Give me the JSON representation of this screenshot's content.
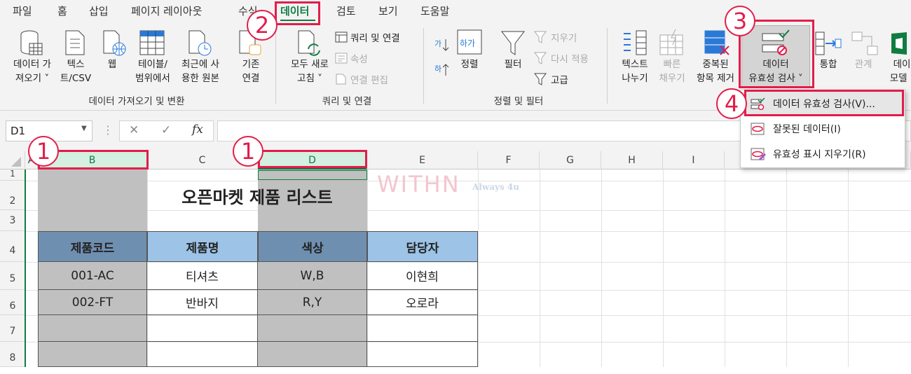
{
  "tabs": [
    "파일",
    "홈",
    "삽입",
    "페이지 레이아웃",
    "수식",
    "데이터",
    "검토",
    "보기",
    "도움말"
  ],
  "active_tab": "데이터",
  "ribbon": {
    "get_data": [
      "데이터 가",
      "져오기 ˅"
    ],
    "text_csv": [
      "텍스",
      "트/CSV"
    ],
    "web": [
      "웹"
    ],
    "table_range": [
      "테이블/",
      "범위에서"
    ],
    "recent_sources": [
      "최근에 사",
      "용한 원본"
    ],
    "existing_conn": [
      "기존",
      "연결"
    ],
    "refresh_all": [
      "모두 새로",
      "고침 ˅"
    ],
    "queries_connections": "쿼리 및 연결",
    "properties": "속성",
    "edit_links": "연결 편집",
    "sort": "정렬",
    "filter": "필터",
    "clear": "지우기",
    "reapply": "다시 적용",
    "advanced": "고급",
    "text_to_columns": [
      "텍스트",
      "나누기"
    ],
    "flash_fill": [
      "빠른",
      "채우기"
    ],
    "remove_duplicates": [
      "중복된",
      "항목 제거"
    ],
    "data_validation": [
      "데이터",
      "유효성 검사 ˅"
    ],
    "consolidate": "통합",
    "relationships": "관계",
    "data_model": [
      "데이",
      "모델 ›"
    ],
    "groups": {
      "get_transform": "데이터 가져오기 및 변환",
      "queries": "쿼리 및 연결",
      "sort_filter": "정렬 및 필터"
    }
  },
  "name_box": "D1",
  "formula_icons": {
    "cancel": "✕",
    "enter": "✓",
    "fx": "fx"
  },
  "columns": [
    "A",
    "B",
    "C",
    "D",
    "E",
    "F",
    "G",
    "H",
    "I"
  ],
  "rows": [
    "1",
    "2",
    "3",
    "4",
    "5",
    "6",
    "7",
    "8"
  ],
  "sheet": {
    "title": "오픈마켓 제품 리스트",
    "headers": [
      "제품코드",
      "제품명",
      "색상",
      "담당자"
    ],
    "data": [
      [
        "001-AC",
        "티셔츠",
        "W,B",
        "이현희"
      ],
      [
        "002-FT",
        "반바지",
        "R,Y",
        "오로라"
      ]
    ]
  },
  "watermark": {
    "brand": "WITHN",
    "tagline": "Always 4u"
  },
  "menu": [
    {
      "label": "데이터 유효성 검사(V)..."
    },
    {
      "label": "잘못된 데이터(I)"
    },
    {
      "label": "유효성 표시 지우기(R)"
    }
  ],
  "annotations": [
    "1",
    "1",
    "2",
    "3",
    "4"
  ],
  "colors": {
    "accent": "#107c41",
    "annot": "#e21d4a",
    "header_dark": "#6f8fb0",
    "header_light": "#9dc3e6",
    "selected_col": "#c0c0c0"
  }
}
